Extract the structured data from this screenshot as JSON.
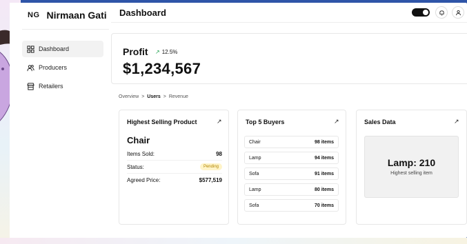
{
  "brand": {
    "mark": "NG",
    "name": "Nirmaan Gati"
  },
  "sidebar": {
    "items": [
      {
        "label": "Dashboard",
        "icon": "grid-icon",
        "active": true
      },
      {
        "label": "Producers",
        "icon": "users-icon",
        "active": false
      },
      {
        "label": "Retailers",
        "icon": "store-icon",
        "active": false
      }
    ]
  },
  "header": {
    "title": "Dashboard",
    "icons": [
      "theme-toggle",
      "bell-icon",
      "user-icon"
    ]
  },
  "profit": {
    "label": "Profit",
    "change": "12.5%",
    "value": "$1,234,567"
  },
  "breadcrumb": {
    "items": [
      "Overview",
      "Users",
      "Revenue"
    ],
    "separator": ">"
  },
  "highest_selling": {
    "title": "Highest Selling Product",
    "product": "Chair",
    "rows": [
      {
        "label": "Items Sold:",
        "value": "98"
      },
      {
        "label": "Status:",
        "value": "Pending"
      },
      {
        "label": "Agreed Price:",
        "value": "$577,519"
      }
    ]
  },
  "top_buyers": {
    "title": "Top 5 Buyers",
    "rows": [
      {
        "name": "Chair",
        "count": "98 items"
      },
      {
        "name": "Lamp",
        "count": "94 items"
      },
      {
        "name": "Sofa",
        "count": "91 items"
      },
      {
        "name": "Lamp",
        "count": "80 items"
      },
      {
        "name": "Sofa",
        "count": "70 items"
      }
    ]
  },
  "sales_data": {
    "title": "Sales Data",
    "main": "Lamp: 210",
    "sub": "Highest selling item"
  },
  "link_glyph": "↗",
  "colors": {
    "background": "#2f55a8",
    "accent_green": "#1a9e4a",
    "pending_bg": "#fff4c8",
    "pending_text": "#b08500"
  }
}
